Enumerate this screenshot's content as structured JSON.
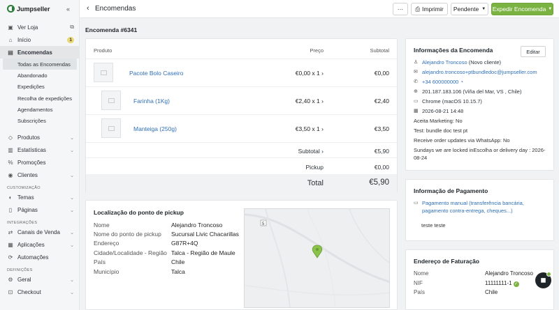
{
  "app": {
    "brand": "Jumpseller",
    "accent_color": "#7bb342",
    "link_color": "#2f6fb7"
  },
  "sidebar": {
    "top_items": [
      {
        "label": "Ver Loja",
        "icon": "store-icon",
        "trailing": "external-link-icon"
      },
      {
        "label": "Início",
        "icon": "home-icon",
        "badge": "1"
      },
      {
        "label": "Encomendas",
        "icon": "orders-icon"
      }
    ],
    "sub_items": [
      "Todas as Encomendas",
      "Abandonado",
      "Expedições",
      "Recolha de expedições",
      "Agendamentos",
      "Subscrições"
    ],
    "main_items": [
      {
        "label": "Produtos",
        "icon": "tag-icon"
      },
      {
        "label": "Estatísticas",
        "icon": "chart-icon"
      },
      {
        "label": "Promoções",
        "icon": "percent-icon"
      },
      {
        "label": "Clientes",
        "icon": "users-icon"
      }
    ],
    "section_customization": "CUSTOMIZAÇÃO",
    "customization_items": [
      {
        "label": "Temas",
        "icon": "palette-icon"
      },
      {
        "label": "Páginas",
        "icon": "file-icon"
      }
    ],
    "section_integrations": "INTEGRAÇÕES",
    "integration_items": [
      {
        "label": "Canais de Venda",
        "icon": "channels-icon"
      },
      {
        "label": "Aplicações",
        "icon": "apps-icon"
      },
      {
        "label": "Automações",
        "icon": "automation-icon"
      }
    ],
    "section_settings": "DEFINIÇÕES",
    "settings_items": [
      {
        "label": "Geral",
        "icon": "gear-icon"
      },
      {
        "label": "Checkout",
        "icon": "cart-icon"
      }
    ]
  },
  "header": {
    "title": "Encomendas",
    "more_label": "···",
    "print_label": "Imprimir",
    "status_label": "Pendente",
    "ship_label": "Expedir Encomenda"
  },
  "order": {
    "title": "Encomenda #6341"
  },
  "products": {
    "columns": {
      "product": "Produto",
      "price": "Preço",
      "subtotal": "Subtotal"
    },
    "rows": [
      {
        "name": "Pacote Bolo Caseiro",
        "price": "€0,00 x 1",
        "subtotal": "€0,00"
      },
      {
        "name": "Farinha (1Kg)",
        "price": "€2,40 x 1",
        "subtotal": "€2,40"
      },
      {
        "name": "Manteiga (250g)",
        "price": "€3,50 x 1",
        "subtotal": "€3,50"
      }
    ],
    "subtotal_label": "Subtotal",
    "subtotal_value": "€5,90",
    "shipping_label": "Pickup",
    "shipping_value": "€0,00",
    "total_label": "Total",
    "total_value": "€5,90"
  },
  "pickup": {
    "title": "Localização do ponto de pickup",
    "fields": [
      {
        "label": "Nome",
        "value": "Alejandro Troncoso"
      },
      {
        "label": "Nome do ponto de pickup",
        "value": "Sucursal Livic Chacarillas"
      },
      {
        "label": "Endereço",
        "value": "G87R+4Q"
      },
      {
        "label": "Cidade/Localidade - Região",
        "value": "Talca - Região de Maule"
      },
      {
        "label": "País",
        "value": "Chile"
      },
      {
        "label": "Município",
        "value": "Talca"
      }
    ],
    "map_road_label": "5"
  },
  "order_info": {
    "title": "Informações da Encomenda",
    "edit_label": "Editar",
    "customer_name": "Alejandro Troncoso",
    "customer_note": "(Novo cliente)",
    "email": "alejandro.troncoso+ptbundledoc@jumpseller.com",
    "phone": "+34 600000000",
    "ip": "201.187.183.106 (Viña del Mar, VS , Chile)",
    "browser": "Chrome (macOS 10.15.7)",
    "date": "2026-08-21 14:48",
    "marketing": "Aceita Marketing: No",
    "test": "Test: bundle doc test pt",
    "whatsapp": "Receive order updates via WhatsApp: No",
    "sundays": "Sundays we are locked inEscolha or delivery day : 2026-08-24"
  },
  "payment": {
    "title": "Informação de Pagamento",
    "method": "Pagamento manual (transferência bancária, pagamento contra-entrega, cheques...)",
    "note": "teste teste"
  },
  "billing": {
    "title": "Endereço de Faturação",
    "fields": [
      {
        "label": "Nome",
        "value": "Alejandro Troncoso"
      },
      {
        "label": "NIF",
        "value": "11111111-1"
      },
      {
        "label": "País",
        "value": "Chile"
      }
    ]
  }
}
